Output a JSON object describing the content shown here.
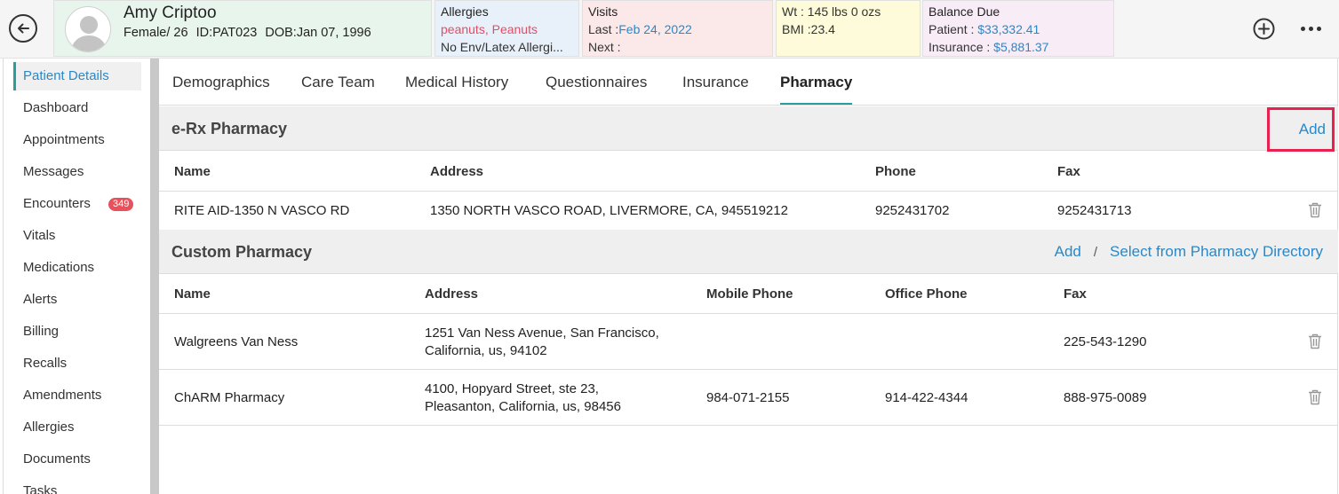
{
  "header": {
    "patient_name": "Amy Criptoo",
    "sex_age": "Female/ 26",
    "patient_id": "ID:PAT023",
    "dob": "DOB:Jan 07, 1996",
    "allergies": {
      "title": "Allergies",
      "drug": "peanuts, Peanuts",
      "env": "No Env/Latex Allergi..."
    },
    "visits": {
      "title": "Visits",
      "last_label": "Last :",
      "last_value": "Feb 24, 2022",
      "next_label": "Next :"
    },
    "vitals": {
      "wt_label": "Wt :",
      "wt_value": "145 lbs 0 ozs",
      "bmi_label": "BMI :",
      "bmi_value": "23.4"
    },
    "balance": {
      "title": "Balance Due",
      "patient_label": "Patient :",
      "patient_value": "$33,332.41",
      "insurance_label": "Insurance :",
      "insurance_value": "$5,881.37"
    }
  },
  "sidebar": {
    "items": [
      {
        "label": "Patient Details",
        "active": true
      },
      {
        "label": "Dashboard"
      },
      {
        "label": "Appointments"
      },
      {
        "label": "Messages"
      },
      {
        "label": "Encounters",
        "badge": "349"
      },
      {
        "label": "Vitals"
      },
      {
        "label": "Medications"
      },
      {
        "label": "Alerts"
      },
      {
        "label": "Billing"
      },
      {
        "label": "Recalls"
      },
      {
        "label": "Amendments"
      },
      {
        "label": "Allergies"
      },
      {
        "label": "Documents"
      },
      {
        "label": "Tasks"
      }
    ]
  },
  "tabs": [
    "Demographics",
    "Care Team",
    "Medical History",
    "Questionnaires",
    "Insurance",
    "Pharmacy"
  ],
  "erx": {
    "title": "e-Rx Pharmacy",
    "add_label": "Add",
    "columns": [
      "Name",
      "Address",
      "Phone",
      "Fax"
    ],
    "rows": [
      {
        "name": "RITE AID-1350 N VASCO RD",
        "address": "1350 NORTH VASCO ROAD,  LIVERMORE,  CA,  945519212",
        "phone": "9252431702",
        "fax": "9252431713"
      }
    ]
  },
  "custom": {
    "title": "Custom Pharmacy",
    "add_label": "Add",
    "separator": "/",
    "directory_label": "Select from Pharmacy Directory",
    "columns": [
      "Name",
      "Address",
      "Mobile Phone",
      "Office Phone",
      "Fax"
    ],
    "rows": [
      {
        "name": "Walgreens Van Ness",
        "address_line1": "1251 Van Ness Avenue,  San Francisco,",
        "address_line2": "California,  us,  94102",
        "mobile": "",
        "office": "",
        "fax": "225-543-1290"
      },
      {
        "name": "ChARM Pharmacy",
        "address_line1": "4100, Hopyard Street,  ste 23,",
        "address_line2": "Pleasanton,  California,  us,  98456",
        "mobile": "984-071-2155",
        "office": "914-422-4344",
        "fax": "888-975-0089"
      }
    ]
  }
}
